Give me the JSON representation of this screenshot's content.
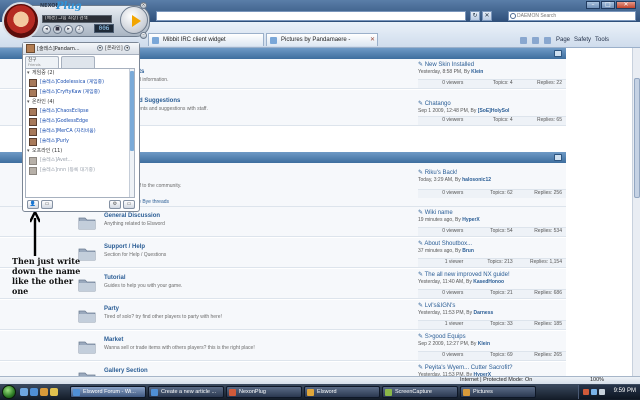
{
  "browser": {
    "search_placeholder": "DAEMON Search",
    "tabs": [
      {
        "label": "Mibbit IRC client widget"
      },
      {
        "label": "Pictures by Pandamaere -"
      }
    ],
    "commands": {
      "page": "Page",
      "safety": "Safety",
      "tools": "Tools"
    },
    "status_zone": "Internet | Protected Mode: On",
    "zoom": "100%"
  },
  "nexonplug": {
    "brand": "NEXON",
    "product": "Plug",
    "track_text": "[배경] 그림 최상] 검색",
    "counter": "006",
    "user_name": "[술레스]Pandam...",
    "status": "[온라인]",
    "tab_friends": "친구",
    "tab_friends_sub": "Friends",
    "groups": [
      {
        "label": "게임중 (2)",
        "friends": [
          {
            "name": "[술레스]Codelessica (게임중)",
            "offline": false
          },
          {
            "name": "[술레스]CryftyKaw (게임중)",
            "offline": false
          }
        ]
      },
      {
        "label": "온라인 (4)",
        "friends": [
          {
            "name": "[술레스]ChaosEclipse",
            "offline": false
          },
          {
            "name": "[술레스]GodlessEdge",
            "offline": false
          },
          {
            "name": "[술레스]MerCA (자리비움)",
            "offline": false
          },
          {
            "name": "[술레스]Purly",
            "offline": false
          }
        ]
      },
      {
        "label": "오프라인 (11)",
        "friends": [
          {
            "name": "[술레스]Avet...",
            "offline": true
          },
          {
            "name": "[술레스]nnn (등록 대기중)",
            "offline": true
          }
        ]
      }
    ]
  },
  "forum": {
    "sections": [
      {
        "title": "...ts",
        "desc": "...d information.",
        "last_title": "New Skin Installed",
        "last_meta": "Yesterday, 8:58 PM,",
        "last_by": "Klein",
        "viewers": "0 viewers",
        "topics": "Topics: 4",
        "replies": "Replies: 22"
      },
      {
        "title": "...d Suggestions",
        "desc": "...ents and suggestions with staff.",
        "last_title": "Chatango",
        "last_meta": "Sep 1 2009, 12:48 PM,",
        "last_by": "[SoE]HolySol",
        "viewers": "0 viewers",
        "topics": "Topics: 4",
        "replies": "Replies: 65"
      }
    ],
    "general_cat": {
      "desc": "...ff to the community.",
      "sub_link": "...e Bye threads",
      "last_title": "Riku's Back!",
      "last_meta": "Today, 3:29 AM,",
      "last_by": "halosonic12",
      "viewers": "0 viewers",
      "topics": "Topics: 62",
      "replies": "Replies: 256"
    },
    "forums": [
      {
        "title": "General Discussion",
        "desc": "Anything related to Elsword",
        "last_title": "Wiki name",
        "last_meta": "19 minutes ago,",
        "last_by": "HyperX",
        "viewers": "0 viewers",
        "topics": "Topics: 54",
        "replies": "Replies: 534"
      },
      {
        "title": "Support / Help",
        "desc": "Section for Help / Questions",
        "last_title": "About Shoutbox...",
        "last_meta": "37 minutes ago,",
        "last_by": "Brun",
        "viewers": "1 viewer",
        "topics": "Topics: 213",
        "replies": "Replies: 1,154"
      },
      {
        "title": "Tutorial",
        "desc": "Guides to help you with your game.",
        "last_title": "The all new improved NX guide!",
        "last_meta": "Yesterday, 11:40 AM,",
        "last_by": "KasedHonoo",
        "viewers": "0 viewers",
        "topics": "Topics: 21",
        "replies": "Replies: 686"
      },
      {
        "title": "Party",
        "desc": "Tired of solo? try find other players to party with here!",
        "last_title": "Lvl's&IGN's",
        "last_meta": "Yesterday, 11:53 PM,",
        "last_by": "Darness",
        "viewers": "1 viewer",
        "topics": "Topics: 33",
        "replies": "Replies: 185"
      },
      {
        "title": "Market",
        "desc": "Wanna sell or trade items with others players? this is the right place!",
        "last_title": "S>good Equips",
        "last_meta": "Sep 2 2009, 12:27 PM,",
        "last_by": "Klein",
        "viewers": "0 viewers",
        "topics": "Topics: 69",
        "replies": "Replies: 265"
      },
      {
        "title": "Gallery Section",
        "desc": "",
        "last_title": "Peyita's Wyem... Cutter Sacrofit?",
        "last_meta": "Yesterday, 11:53 PM,",
        "last_by": "HyperX",
        "viewers": "",
        "topics": "",
        "replies": ""
      }
    ]
  },
  "annotation": "Then just write down the name like the other one",
  "taskbar": {
    "buttons": [
      {
        "label": "Elsword Forum - Wi..."
      },
      {
        "label": "Create a new article ..."
      },
      {
        "label": "NexonPlug"
      },
      {
        "label": "Elsword"
      },
      {
        "label": "ScreenCapture"
      },
      {
        "label": "Pictures"
      }
    ],
    "clock": "9:59 PM"
  }
}
